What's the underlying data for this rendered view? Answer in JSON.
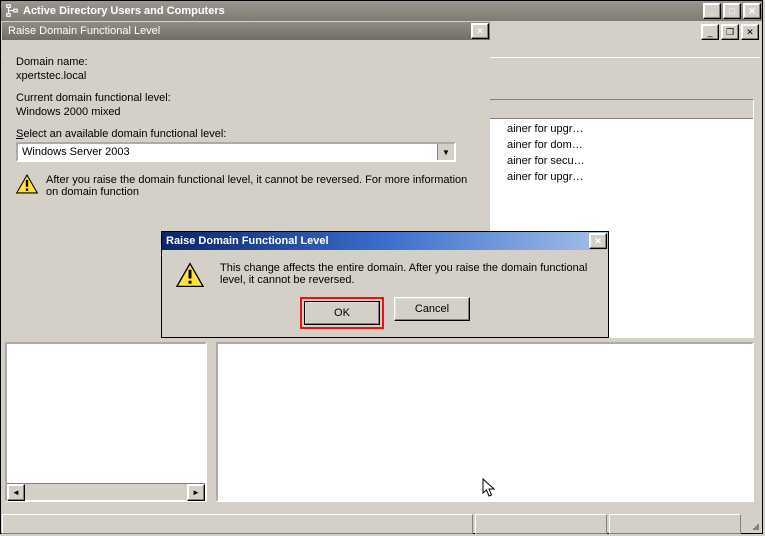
{
  "main_window": {
    "title": "Active Directory Users and Computers"
  },
  "list": {
    "rows": [
      "ainer for upgr…",
      "ainer for dom…",
      "ainer for secu…",
      "ainer for upgr…"
    ]
  },
  "dialog1": {
    "title": "Raise Domain Functional Level",
    "domain_name_label": "Domain name:",
    "domain_name_value": "xpertstec.local",
    "current_level_label": "Current domain functional level:",
    "current_level_value": "Windows 2000 mixed",
    "select_label_a": "S",
    "select_label_b": "elect an available domain functional level:",
    "combo_value": "Windows Server 2003",
    "warning_line1": "After you raise the domain functional level, it cannot be reversed. For more information",
    "warning_line2": "on domain function"
  },
  "dialog2": {
    "title": "Raise Domain Functional Level",
    "message": "This change affects the entire domain. After you raise the domain functional level, it cannot be reversed.",
    "ok": "OK",
    "cancel": "Cancel"
  },
  "icons": {
    "min": "_",
    "max": "□",
    "restore": "❐",
    "close": "✕",
    "combo_down": "▼",
    "scroll_left": "◄",
    "scroll_right": "►"
  }
}
